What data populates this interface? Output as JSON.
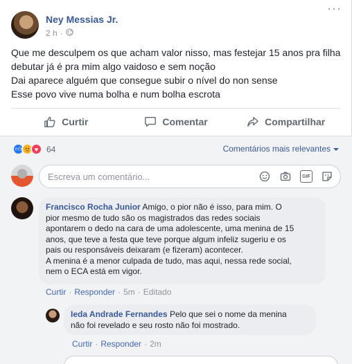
{
  "post": {
    "author": "Ney Messias Jr.",
    "time": "2 h",
    "separator": "·",
    "more": "···",
    "text_lines": [
      "Que me desculpem os que acham valor nisso, mas festejar 15 anos pra filha",
      "debutar já é pra mim algo vaidoso e sem noção",
      "Dai aparece alguém que consegue subir o nível do non sense",
      "Esse povo vive numa bolha e num bolha escrota"
    ]
  },
  "actions": {
    "like": "Curtir",
    "comment": "Comentar",
    "share": "Compartilhar"
  },
  "reactions": {
    "count": "64",
    "sort_label": "Comentários mais relevantes"
  },
  "composer": {
    "placeholder": "Escreva um comentário..."
  },
  "comments": [
    {
      "author": "Francisco Rocha Junior",
      "lines": [
        "Amigo, o pior não é isso, para mim. O",
        "pior mesmo de tudo são os magistrados das redes sociais",
        "apontarem o dedo na cara de uma adolescente, uma menina de 15",
        "anos, que teve a festa que teve porque algum infeliz sugeriu e os",
        "pais ou responsáveis deixaram (e fizeram) acontecer.",
        "A menina é a menor culpada de tudo, mas aqui, nessa rede social,",
        "nem o ECA está em vigor."
      ],
      "like": "Curtir",
      "reply": "Responder",
      "time": "5m",
      "edited": "Editado"
    },
    {
      "author": "Ieda Andrade Fernandes",
      "lines": [
        "Pelo que sei o nome da menina",
        "não foi revelado e seu rosto não foi mostrado."
      ],
      "like": "Curtir",
      "reply": "Responder",
      "time": "2m"
    }
  ],
  "colors": {
    "link": "#385898",
    "like_blue": "#2078f4",
    "love_red": "#f33e58",
    "sad_yellow": "#f7b125"
  }
}
